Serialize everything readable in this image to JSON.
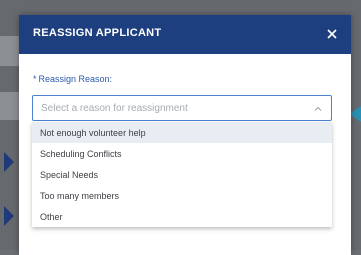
{
  "modal": {
    "title": "REASSIGN APPLICANT",
    "close_icon": "close-icon"
  },
  "form": {
    "required_marker": "*",
    "label": "Reassign Reason:",
    "placeholder": "Select a reason for reassignment",
    "chevron_icon": "chevron-up-icon"
  },
  "options": [
    {
      "label": "Not enough volunteer help",
      "highlighted": true
    },
    {
      "label": "Scheduling Conflicts",
      "highlighted": false
    },
    {
      "label": "Special Needs",
      "highlighted": false
    },
    {
      "label": "Too many members",
      "highlighted": false
    },
    {
      "label": "Other",
      "highlighted": false
    }
  ],
  "colors": {
    "header": "#1e3f7f",
    "label_text": "#2b5aa8",
    "select_border": "#4b83d1",
    "highlight": "#e8ecf3"
  }
}
